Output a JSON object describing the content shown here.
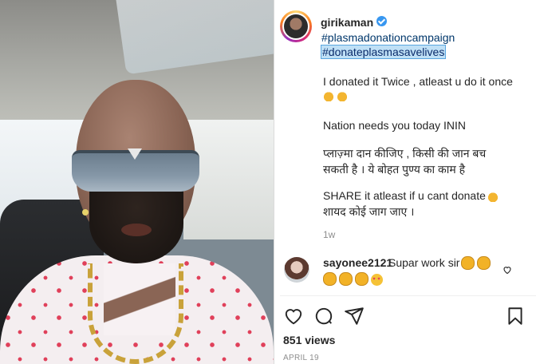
{
  "post": {
    "username": "girikaman",
    "hashtags": [
      "#plasmadonationcampaign",
      "#donateplasmasavelives"
    ],
    "caption_lines": [
      "I donated it Twice , atleast u do it once",
      "Nation needs you today ININ",
      "प्लाज़्मा दान कीजिए , किसी की जान बच",
      "सकती है । ये बोहत पुण्य का काम है",
      "SHARE it atleast if u cant donate",
      "शायद कोई जाग जाए ।"
    ],
    "time_ago": "1w",
    "likes": "851 views",
    "date": "APRIL 19"
  },
  "comment": {
    "username": "sayonee2121",
    "text": "Supar work sir"
  },
  "icons": {
    "verified": "verified-badge-icon",
    "like": "heart-icon",
    "comment": "comment-bubble-icon",
    "share": "paper-plane-icon",
    "save": "bookmark-icon",
    "comment_like": "small-heart-icon"
  },
  "colors": {
    "accent_link": "#00376b",
    "verified": "#3897f0",
    "selected_highlight": "#bfe0f6",
    "muted": "#8e8e8e"
  }
}
